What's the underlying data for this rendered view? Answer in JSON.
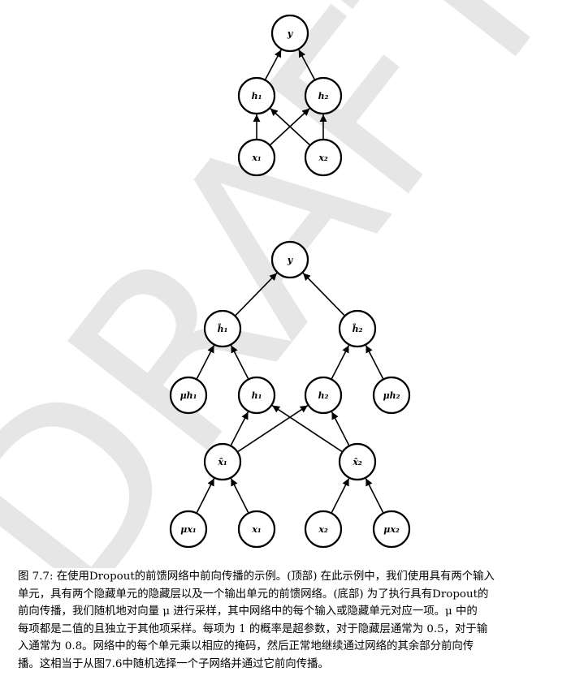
{
  "watermark": "DRAFT",
  "top_diagram": {
    "nodes": [
      {
        "id": "t-y",
        "label": "y"
      },
      {
        "id": "t-h1",
        "label": "h₁"
      },
      {
        "id": "t-h2",
        "label": "h₂"
      },
      {
        "id": "t-x1",
        "label": "x₁"
      },
      {
        "id": "t-x2",
        "label": "x₂"
      }
    ]
  },
  "bottom_diagram": {
    "nodes": [
      {
        "id": "b-y",
        "label": "y"
      },
      {
        "id": "b-h1hat",
        "label": "ĥ₁"
      },
      {
        "id": "b-h2hat",
        "label": "ĥ₂"
      },
      {
        "id": "b-muh1",
        "label": "μh₁"
      },
      {
        "id": "b-h1",
        "label": "h₁"
      },
      {
        "id": "b-h2",
        "label": "h₂"
      },
      {
        "id": "b-muh2",
        "label": "μh₂"
      },
      {
        "id": "b-x1hat",
        "label": "x̂₁"
      },
      {
        "id": "b-x2hat",
        "label": "x̂₂"
      },
      {
        "id": "b-mux1",
        "label": "μx₁"
      },
      {
        "id": "b-x1",
        "label": "x₁"
      },
      {
        "id": "b-x2",
        "label": "x₂"
      },
      {
        "id": "b-mux2",
        "label": "μx₂"
      }
    ]
  },
  "caption": {
    "lines": [
      "图 7.7: 在使用Dropout的前馈网络中前向传播的示例。(顶部) 在此示例中，我们使用具有两个输入",
      "单元，具有两个隐藏单元的隐藏层以及一个输出单元的前馈网络。(底部) 为了执行具有Dropout的",
      "前向传播，我们随机地对向量 μ 进行采样，其中网络中的每个输入或隐藏单元对应一项。μ 中的",
      "每项都是二值的且独立于其他项采样。每项为 1 的概率是超参数，对于隐藏层通常为 0.5，对于输",
      "入通常为 0.8。网络中的每个单元乘以相应的掩码，然后正常地继续通过网络的其余部分前向传",
      "播。这相当于从图7.6中随机选择一个子网络并通过它前向传播。"
    ]
  }
}
